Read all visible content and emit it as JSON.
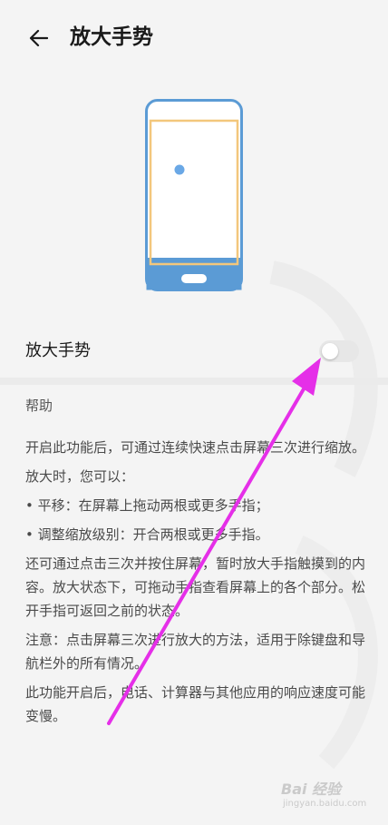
{
  "header": {
    "title": "放大手势",
    "back_icon": "back-arrow-icon"
  },
  "toggle_row": {
    "label": "放大手势",
    "enabled": false
  },
  "help": {
    "title": "帮助",
    "paragraphs": [
      "开启此功能后，可通过连续快速点击屏幕三次进行缩放。",
      "放大时，您可以：",
      "• 平移：在屏幕上拖动两根或更多手指；",
      "• 调整缩放级别：开合两根或更多手指。",
      "还可通过点击三次并按住屏幕，暂时放大手指触摸到的内容。放大状态下，可拖动手指查看屏幕上的各个部分。松开手指可返回之前的状态。",
      "注意：点击屏幕三次进行放大的方法，适用于除键盘和导航栏外的所有情况。",
      "此功能开启后，电话、计算器与其他应用的响应速度可能变慢。"
    ]
  },
  "watermark": {
    "brand": "Bai 经验",
    "url": "jingyan.baidu.com"
  },
  "colors": {
    "phone_outline": "#5b9bd5",
    "zoom_frame": "#f3c77c",
    "touch_dot": "#6aa8e6",
    "annotation_arrow": "#e52fe8"
  }
}
